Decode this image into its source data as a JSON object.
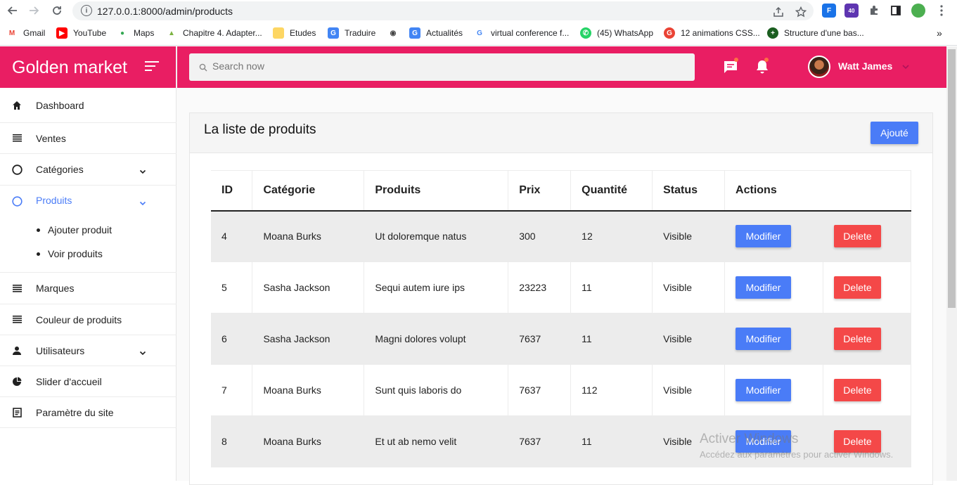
{
  "browser": {
    "url": "127.0.0.1:8000/admin/products",
    "bookmarks": [
      {
        "label": "Gmail",
        "icon": "gmail-icon"
      },
      {
        "label": "YouTube",
        "icon": "youtube-icon"
      },
      {
        "label": "Maps",
        "icon": "maps-icon"
      },
      {
        "label": "Chapitre 4. Adapter...",
        "icon": "bookmark-icon"
      },
      {
        "label": "Etudes",
        "icon": "folder-icon"
      },
      {
        "label": "Traduire",
        "icon": "translate-icon"
      },
      {
        "label": "",
        "icon": "globe-icon"
      },
      {
        "label": "Actualités",
        "icon": "news-icon"
      },
      {
        "label": "virtual conference f...",
        "icon": "google-icon"
      },
      {
        "label": "(45) WhatsApp",
        "icon": "whatsapp-icon"
      },
      {
        "label": "12 animations CSS...",
        "icon": "g-icon"
      },
      {
        "label": "Structure d'une bas...",
        "icon": "structure-icon"
      }
    ],
    "ext_badge": "40"
  },
  "brand": {
    "name": "Golden market",
    "color": "#e91e63"
  },
  "sidebar": {
    "items": [
      {
        "label": "Dashboard",
        "icon": "home-icon"
      },
      {
        "label": "Ventes",
        "icon": "list-icon"
      },
      {
        "label": "Catégories",
        "icon": "circle-icon"
      },
      {
        "label": "Produits",
        "icon": "circle-icon"
      },
      {
        "label": "Marques",
        "icon": "list-icon"
      },
      {
        "label": "Couleur de produits",
        "icon": "list-icon"
      },
      {
        "label": "Utilisateurs",
        "icon": "person-icon"
      },
      {
        "label": "Slider d'accueil",
        "icon": "pie-icon"
      },
      {
        "label": "Paramètre du site",
        "icon": "document-icon"
      }
    ],
    "sub_items": [
      {
        "label": "Ajouter produit"
      },
      {
        "label": "Voir produits"
      }
    ]
  },
  "topbar": {
    "search_placeholder": "Search now",
    "user_name": "Watt James"
  },
  "card": {
    "title": "La liste de produits",
    "add_label": "Ajouté"
  },
  "table": {
    "headers": [
      "ID",
      "Catégorie",
      "Produits",
      "Prix",
      "Quantité",
      "Status",
      "Actions"
    ],
    "edit_label": "Modifier",
    "delete_label": "Delete",
    "rows": [
      {
        "id": "4",
        "category": "Moana Burks",
        "product": "Ut doloremque natus",
        "price": "300",
        "qty": "12",
        "status": "Visible"
      },
      {
        "id": "5",
        "category": "Sasha Jackson",
        "product": "Sequi autem iure ips",
        "price": "23223",
        "qty": "11",
        "status": "Visible"
      },
      {
        "id": "6",
        "category": "Sasha Jackson",
        "product": "Magni dolores volupt",
        "price": "7637",
        "qty": "11",
        "status": "Visible"
      },
      {
        "id": "7",
        "category": "Moana Burks",
        "product": "Sunt quis laboris do",
        "price": "7637",
        "qty": "112",
        "status": "Visible"
      },
      {
        "id": "8",
        "category": "Moana Burks",
        "product": "Et ut ab nemo velit",
        "price": "7637",
        "qty": "11",
        "status": "Visible"
      }
    ]
  },
  "watermark": {
    "line1": "Activer Windows",
    "line2": "Accédez aux paramètres pour activer Windows."
  }
}
